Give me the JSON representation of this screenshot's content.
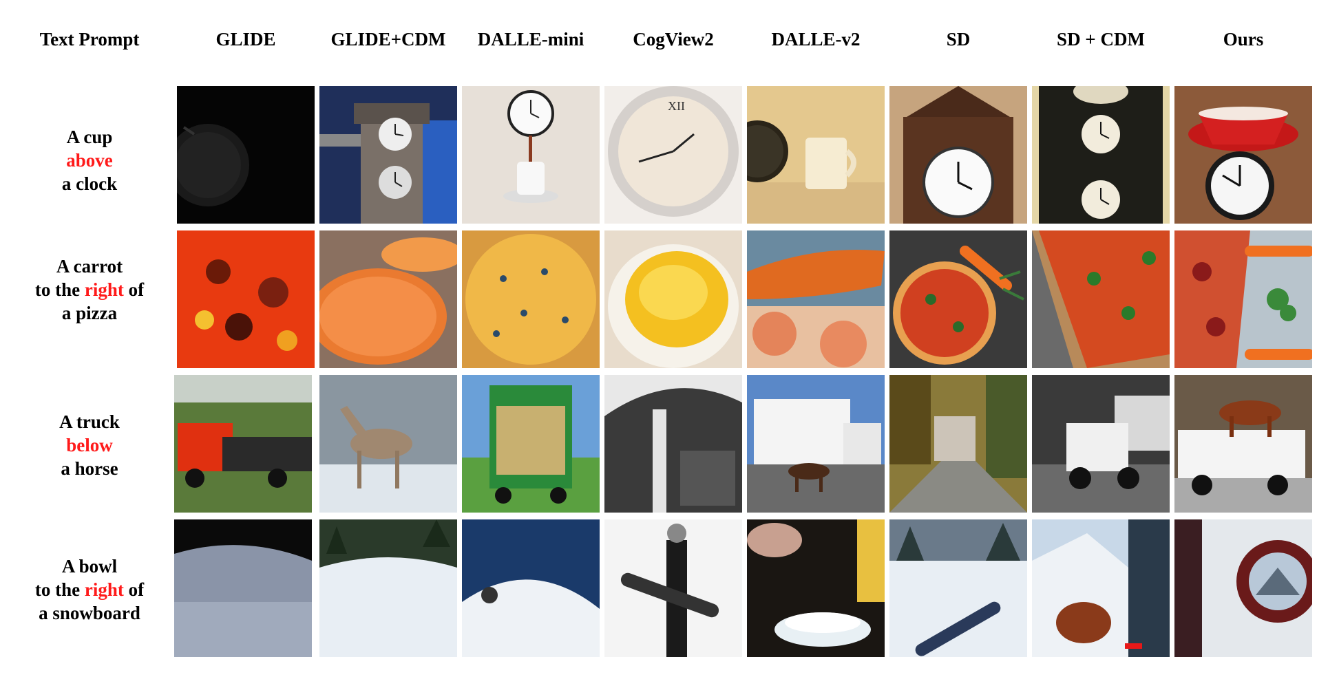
{
  "headers": [
    "Text Prompt",
    "GLIDE",
    "GLIDE+CDM",
    "DALLE-mini",
    "CogView2",
    "DALLE-v2",
    "SD",
    "SD + CDM",
    "Ours"
  ],
  "prompts": [
    {
      "pre": "A cup",
      "word": "above",
      "post": "",
      "last": "a clock"
    },
    {
      "pre": "A carrot",
      "mid_pre": "to the ",
      "word": "right",
      "mid_post": " of",
      "last": "a pizza"
    },
    {
      "pre": "A truck",
      "word": "below",
      "post": "",
      "last": "a horse"
    },
    {
      "pre": "A bowl",
      "mid_pre": "to the ",
      "word": "right",
      "mid_post": " of",
      "last": "a snowboard"
    }
  ],
  "colors": {
    "highlight": "#ff1a1a"
  }
}
